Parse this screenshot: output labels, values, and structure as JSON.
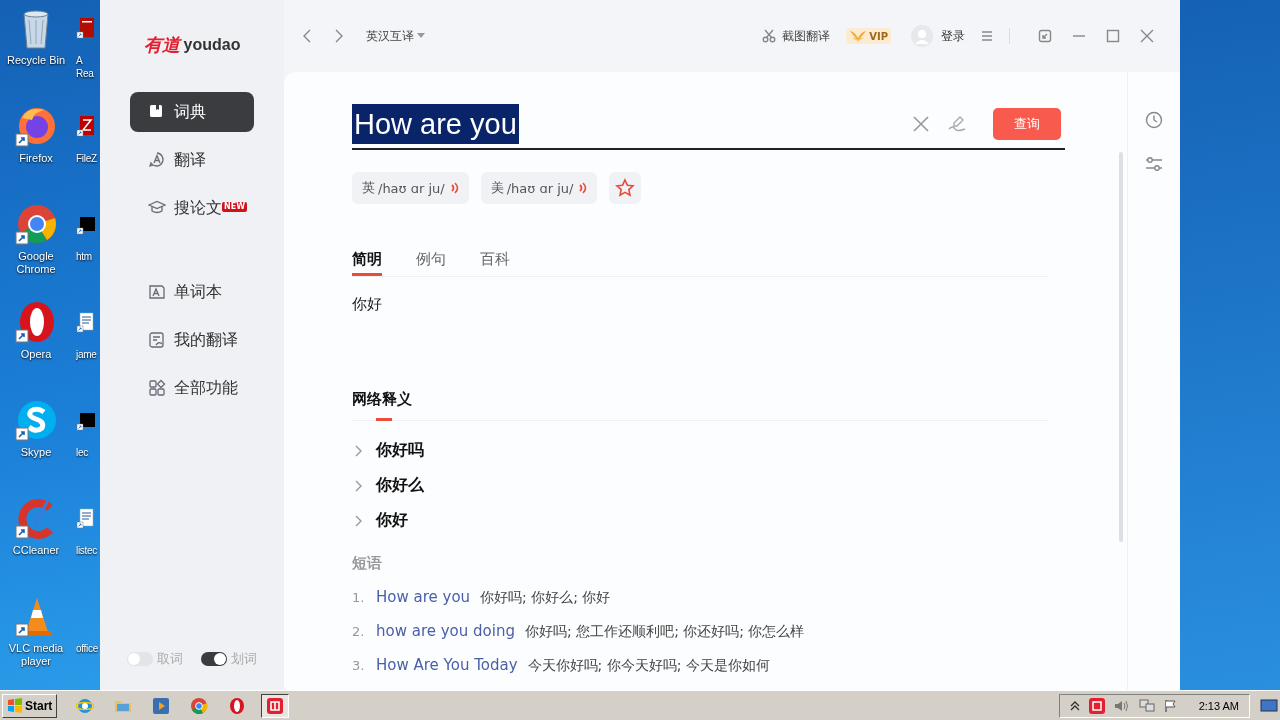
{
  "desktop": {
    "columns": [
      {
        "icons": [
          {
            "kind": "recycle-bin",
            "label": "Recycle Bin"
          },
          {
            "kind": "firefox",
            "label": "Firefox"
          },
          {
            "kind": "chrome",
            "label": "Google Chrome"
          },
          {
            "kind": "opera",
            "label": "Opera"
          },
          {
            "kind": "skype",
            "label": "Skype"
          },
          {
            "kind": "ccleaner",
            "label": "CCleaner"
          },
          {
            "kind": "vlc",
            "label": "VLC media player"
          }
        ]
      },
      {
        "icons": [
          {
            "kind": "pdf",
            "label": "A Rea"
          },
          {
            "kind": "filezilla",
            "label": "FileZ"
          },
          {
            "kind": "black",
            "label": "htm"
          },
          {
            "kind": "doc",
            "label": "jame"
          },
          {
            "kind": "black",
            "label": "lec"
          },
          {
            "kind": "doc",
            "label": "listec"
          },
          {
            "kind": "blank",
            "label": "office"
          }
        ]
      }
    ]
  },
  "app": {
    "logo": {
      "brand_cn": "有道",
      "brand": "youdao"
    },
    "sidebar": {
      "primary_items": [
        {
          "kind": "book",
          "label": "词典",
          "selected": true
        },
        {
          "kind": "translate",
          "label": "翻译",
          "selected": false
        },
        {
          "kind": "cap",
          "label": "搜论文",
          "selected": false,
          "badge": "NEW"
        }
      ],
      "secondary_items": [
        {
          "kind": "wordbook",
          "label": "单词本",
          "selected": false
        },
        {
          "kind": "notes",
          "label": "我的翻译",
          "selected": false
        },
        {
          "kind": "grid",
          "label": "全部功能",
          "selected": false
        }
      ],
      "toggles": [
        {
          "label": "取词",
          "on": false
        },
        {
          "label": "划词",
          "on": true
        }
      ]
    },
    "top_bar": {
      "language": "英汉互译",
      "screenshot_translate": "截图翻译",
      "vip": "VIP",
      "login": "登录"
    },
    "search": {
      "value": "How are you",
      "text_selected": true,
      "button": "查询"
    },
    "pronunciations": [
      {
        "region": "英",
        "phonetic": "/haʊ ɑr ju/"
      },
      {
        "region": "美",
        "phonetic": "/haʊ ɑr ju/"
      }
    ],
    "favorite": {
      "starred": false
    },
    "tabs": [
      {
        "label": "简明",
        "selected": true
      },
      {
        "label": "例句",
        "selected": false
      },
      {
        "label": "百科",
        "selected": false
      }
    ],
    "brief": "你好",
    "web_definitions": {
      "title": "网络释义",
      "items": [
        {
          "text": "你好吗",
          "expanded": false
        },
        {
          "text": "你好么",
          "expanded": false
        },
        {
          "text": "你好",
          "expanded": false
        }
      ]
    },
    "phrases": {
      "title": "短语",
      "items": [
        {
          "number": "1.",
          "phrase": "How are you",
          "meaning": "你好吗; 你好么; 你好"
        },
        {
          "number": "2.",
          "phrase": "how are you doing",
          "meaning": "你好吗; 您工作还顺利吧; 你还好吗; 你怎么样"
        },
        {
          "number": "3.",
          "phrase": "How Are You Today",
          "meaning": "今天你好吗; 你今天好吗; 今天是你如何"
        }
      ]
    }
  },
  "taskbar": {
    "start": "Start",
    "apps": [
      {
        "kind": "ie",
        "active": false
      },
      {
        "kind": "folder",
        "active": false
      },
      {
        "kind": "media",
        "active": false
      },
      {
        "kind": "chrome",
        "active": false
      },
      {
        "kind": "opera",
        "active": false
      },
      {
        "kind": "youdao",
        "active": true
      }
    ],
    "clock": "2:13 AM"
  }
}
